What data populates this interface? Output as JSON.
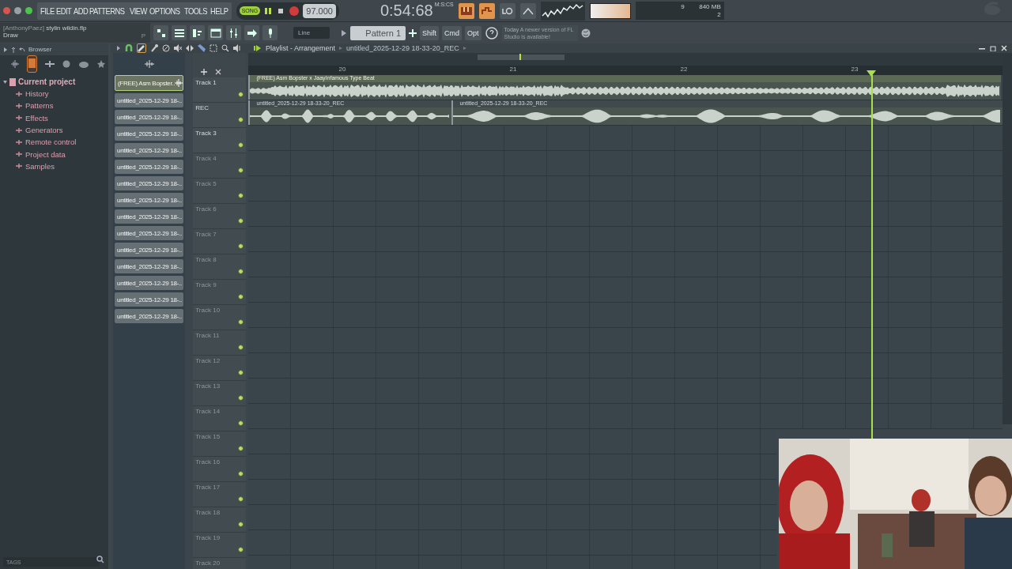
{
  "window": {
    "menu": [
      "FILE",
      "EDIT",
      "ADD",
      "PATTERNS",
      "VIEW",
      "OPTIONS",
      "TOOLS",
      "HELP"
    ]
  },
  "transport": {
    "mode": "SONG",
    "playing": true,
    "tempo": "97.000",
    "time": "0:54:68",
    "time_format": "M:S:CS",
    "cpu": "9",
    "memory": "840 MB",
    "polyphony": "2"
  },
  "hint_bar": {
    "owner": "[AnthonyPaez]",
    "file": "stylin wildin.flp",
    "hint": "Draw",
    "shortcut": "P"
  },
  "toolbar": {
    "snap": "Line",
    "pattern": "Pattern 1",
    "modifiers": [
      "Shift",
      "Cmd",
      "Opt"
    ],
    "news_date": "Today",
    "news_text": "A newer version of FL Studio is available!"
  },
  "browser": {
    "title": "Browser",
    "tree": [
      {
        "label": "Current project",
        "expanded": true,
        "children": [
          {
            "label": "History"
          },
          {
            "label": "Patterns"
          },
          {
            "label": "Effects"
          },
          {
            "label": "Generators"
          },
          {
            "label": "Remote control"
          },
          {
            "label": "Project data"
          },
          {
            "label": "Samples"
          }
        ]
      }
    ]
  },
  "playlist": {
    "title": "Playlist - Arrangement",
    "breadcrumb": "untitled_2025-12-29 18-33-20_REC",
    "clip_list": [
      {
        "label": "(FREE) Asm Bopster..",
        "selected": true
      },
      {
        "label": "untitled_2025-12-29 18-..",
        "selected": false
      },
      {
        "label": "untitled_2025-12-29 18-..",
        "selected": false
      },
      {
        "label": "untitled_2025-12-29 18-..",
        "selected": false
      },
      {
        "label": "untitled_2025-12-29 18-..",
        "selected": false
      },
      {
        "label": "untitled_2025-12-29 18-..",
        "selected": false
      },
      {
        "label": "untitled_2025-12-29 18-..",
        "selected": false
      },
      {
        "label": "untitled_2025-12-29 18-..",
        "selected": false
      },
      {
        "label": "untitled_2025-12-29 18-..",
        "selected": false
      },
      {
        "label": "untitled_2025-12-29 18-..",
        "selected": false
      },
      {
        "label": "untitled_2025-12-29 18-..",
        "selected": false
      },
      {
        "label": "untitled_2025-12-29 18-..",
        "selected": false
      },
      {
        "label": "untitled_2025-12-29 18-..",
        "selected": false
      },
      {
        "label": "untitled_2025-12-29 18-..",
        "selected": false
      },
      {
        "label": "untitled_2025-12-29 18-..",
        "selected": false
      }
    ],
    "ruler": [
      "20",
      "21",
      "22",
      "23"
    ],
    "tracks": [
      {
        "name": "Track 1",
        "empty": false,
        "clips": [
          {
            "label": "(FREE) Asm Bopster x JaayInfamous Type Beat",
            "kind": "beat"
          }
        ]
      },
      {
        "name": "REC",
        "empty": false,
        "clips": [
          {
            "label": "untitled_2025-12-29 18-33-20_REC",
            "kind": "vocal"
          },
          {
            "label": "untitled_2025-12-29 18-33-20_REC",
            "kind": "vocal"
          }
        ]
      },
      {
        "name": "Track 3",
        "empty": false
      },
      {
        "name": "Track 4",
        "empty": true
      },
      {
        "name": "Track 5",
        "empty": true
      },
      {
        "name": "Track 6",
        "empty": true
      },
      {
        "name": "Track 7",
        "empty": true
      },
      {
        "name": "Track 8",
        "empty": true
      },
      {
        "name": "Track 9",
        "empty": true
      },
      {
        "name": "Track 10",
        "empty": true
      },
      {
        "name": "Track 11",
        "empty": true
      },
      {
        "name": "Track 12",
        "empty": true
      },
      {
        "name": "Track 13",
        "empty": true
      },
      {
        "name": "Track 14",
        "empty": true
      },
      {
        "name": "Track 15",
        "empty": true
      },
      {
        "name": "Track 16",
        "empty": true
      },
      {
        "name": "Track 17",
        "empty": true
      },
      {
        "name": "Track 18",
        "empty": true
      },
      {
        "name": "Track 19",
        "empty": true
      },
      {
        "name": "Track 20",
        "empty": true
      }
    ]
  },
  "tags_field": {
    "placeholder": "TAGS"
  }
}
